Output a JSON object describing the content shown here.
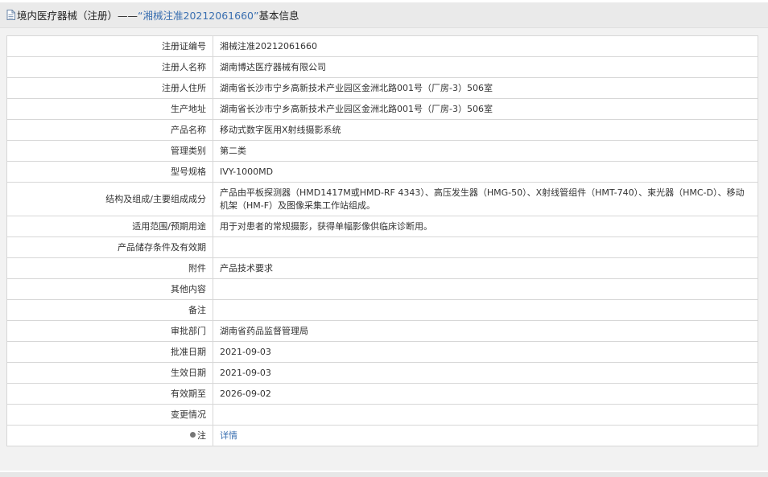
{
  "header": {
    "prefix": "境内医疗器械（注册）——",
    "reg_quoted": "“湘械注准20212061660”",
    "suffix": "基本信息"
  },
  "rows": [
    {
      "label": "注册证编号",
      "value": "湘械注准20212061660"
    },
    {
      "label": "注册人名称",
      "value": "湖南博达医疗器械有限公司"
    },
    {
      "label": "注册人住所",
      "value": "湖南省长沙市宁乡高新技术产业园区金洲北路001号（厂房-3）506室"
    },
    {
      "label": "生产地址",
      "value": "湖南省长沙市宁乡高新技术产业园区金洲北路001号（厂房-3）506室"
    },
    {
      "label": "产品名称",
      "value": "移动式数字医用X射线摄影系统"
    },
    {
      "label": "管理类别",
      "value": "第二类"
    },
    {
      "label": "型号规格",
      "value": "IVY-1000MD"
    },
    {
      "label": "结构及组成/主要组成成分",
      "value": "产品由平板探测器（HMD1417M或HMD-RF 4343）、高压发生器（HMG-50）、X射线管组件（HMT-740）、束光器（HMC-D）、移动机架（HM-F）及图像采集工作站组成。"
    },
    {
      "label": "适用范围/预期用途",
      "value": "用于对患者的常规摄影，获得单幅影像供临床诊断用。"
    },
    {
      "label": "产品储存条件及有效期",
      "value": ""
    },
    {
      "label": "附件",
      "value": "产品技术要求"
    },
    {
      "label": "其他内容",
      "value": ""
    },
    {
      "label": "备注",
      "value": ""
    },
    {
      "label": "审批部门",
      "value": "湖南省药品监督管理局"
    },
    {
      "label": "批准日期",
      "value": "2021-09-03"
    },
    {
      "label": "生效日期",
      "value": "2021-09-03"
    },
    {
      "label": "有效期至",
      "value": "2026-09-02"
    },
    {
      "label": "变更情况",
      "value": ""
    }
  ],
  "note_row": {
    "label": "注",
    "link_text": "详情",
    "icon": "pin-icon"
  },
  "icons": {
    "header": "document-icon"
  },
  "colors": {
    "link": "#3a6fb0",
    "header_bg": "#eaeaea",
    "border": "#d7d7d7"
  }
}
